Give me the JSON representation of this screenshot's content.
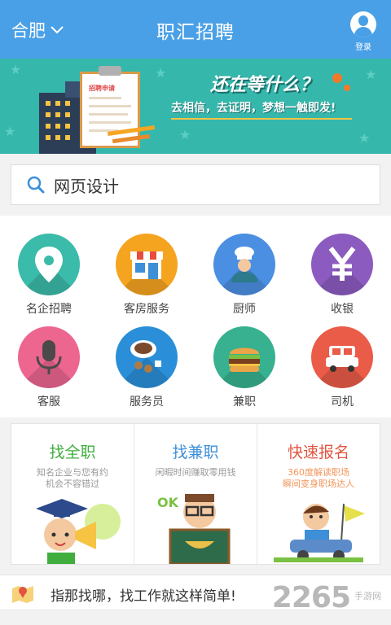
{
  "header": {
    "city": "合肥",
    "title": "职汇招聘",
    "login_label": "登录",
    "color": "#4aa0e6"
  },
  "banner": {
    "headline": "还在等什么？",
    "tagline": "去相信，去证明，梦想一触即发!",
    "doc_title": "招聘申请",
    "color": "#36b7ac"
  },
  "search": {
    "value": "网页设计",
    "icon": "search-icon"
  },
  "categories": [
    {
      "label": "名企招聘",
      "icon": "map-pin-icon",
      "color": "#3bbba9"
    },
    {
      "label": "客房服务",
      "icon": "storefront-icon",
      "color": "#f5a41f"
    },
    {
      "label": "厨师",
      "icon": "chef-icon",
      "color": "#4b8fe2"
    },
    {
      "label": "收银",
      "icon": "yen-icon",
      "color": "#8c5bc0"
    },
    {
      "label": "客服",
      "icon": "microphone-icon",
      "color": "#ec6690"
    },
    {
      "label": "服务员",
      "icon": "coffee-cup-icon",
      "color": "#2a8fd8"
    },
    {
      "label": "兼职",
      "icon": "burger-icon",
      "color": "#37b18f"
    },
    {
      "label": "司机",
      "icon": "car-icon",
      "color": "#ea5b48"
    }
  ],
  "cards": [
    {
      "title": "找全职",
      "subtitle_1": "知名企业与您有约",
      "subtitle_2": "机会不容错过",
      "color": "#3fae3f"
    },
    {
      "title": "找兼职",
      "subtitle_1": "闲暇时间赚取零用钱",
      "subtitle_2": "",
      "color": "#3d8fd8"
    },
    {
      "title": "快速报名",
      "subtitle_1": "360度解读职场",
      "subtitle_2": "瞬间变身职场达人",
      "color": "#e2543f"
    }
  ],
  "promo": {
    "text": "指那找哪，找工作就这样简单!"
  },
  "watermark": {
    "brand": "2265",
    "sub": "手游网"
  }
}
